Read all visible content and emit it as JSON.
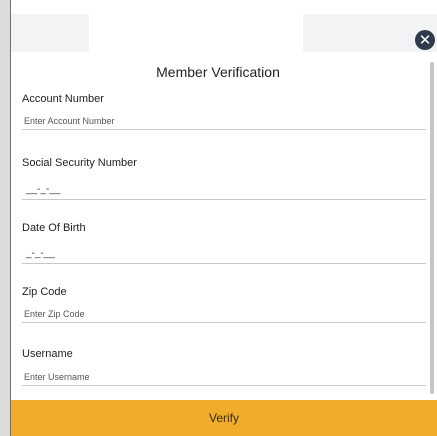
{
  "dialog": {
    "title": "Member Verification",
    "close_icon": "close-icon"
  },
  "fields": {
    "account_number": {
      "label": "Account Number",
      "placeholder": "Enter Account Number"
    },
    "ssn": {
      "label": "Social Security Number",
      "mask": "__-_-__"
    },
    "dob": {
      "label": "Date Of Birth",
      "mask": "_-_-__"
    },
    "zip": {
      "label": "Zip Code",
      "placeholder": "Enter Zip Code"
    },
    "username": {
      "label": "Username",
      "placeholder": "Enter Username"
    }
  },
  "actions": {
    "verify_label": "Verify"
  },
  "colors": {
    "accent": "#f0ad2b",
    "close_button": "#2f3b4c"
  }
}
